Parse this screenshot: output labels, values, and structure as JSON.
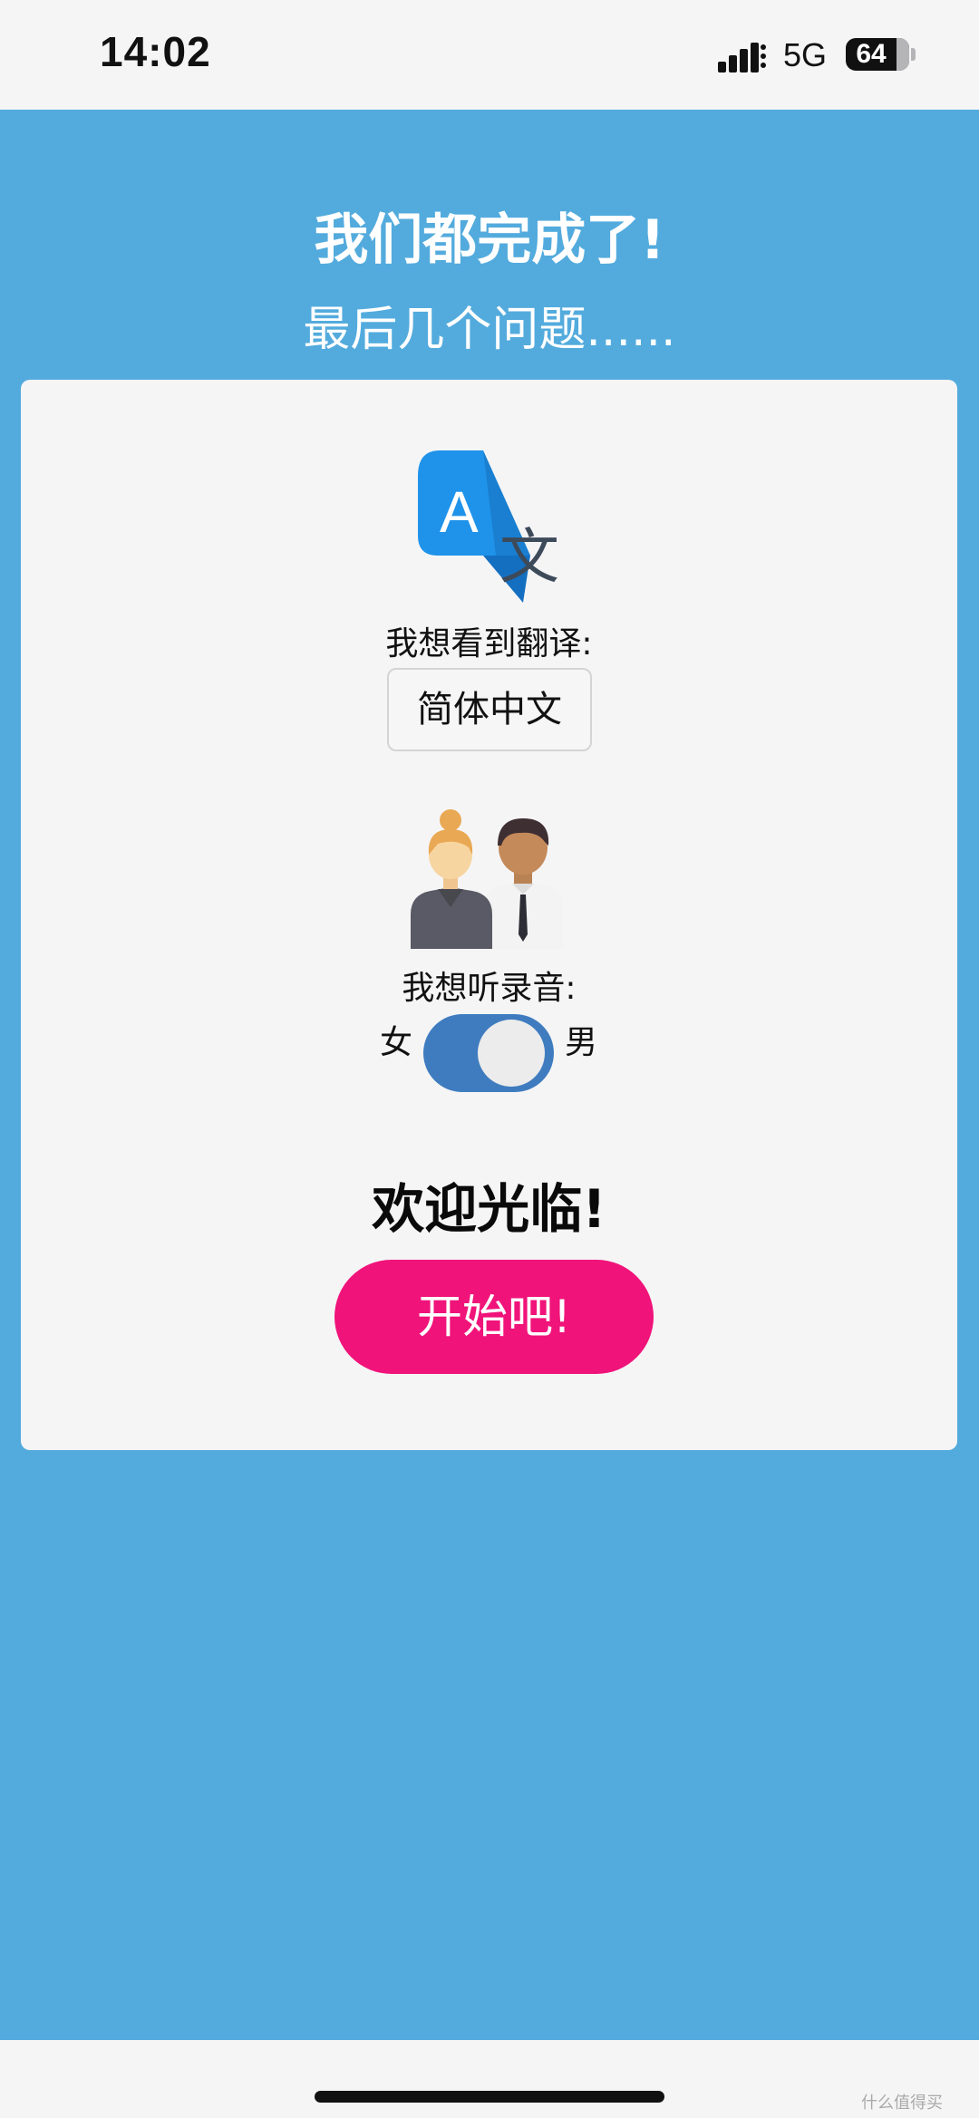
{
  "status_bar": {
    "time": "14:02",
    "network": "5G",
    "battery": "64",
    "signal_icon": "cellular-signal-icon",
    "battery_icon": "battery-icon"
  },
  "header": {
    "title": "我们都完成了!",
    "subtitle": "最后几个问题......"
  },
  "translation": {
    "icon": "translate-icon",
    "label": "我想看到翻译:",
    "selected_language": "简体中文"
  },
  "audio": {
    "icon": "speakers-icon",
    "label": "我想听录音:",
    "female_label": "女",
    "male_label": "男",
    "selected": "男"
  },
  "welcome": {
    "text": "欢迎光临!",
    "start_label": "开始吧!"
  },
  "watermark": "什么值得买",
  "colors": {
    "background_blue": "#53abdd",
    "card": "#f5f5f6",
    "start_button": "#f0137a",
    "toggle": "#3f7cbf"
  }
}
